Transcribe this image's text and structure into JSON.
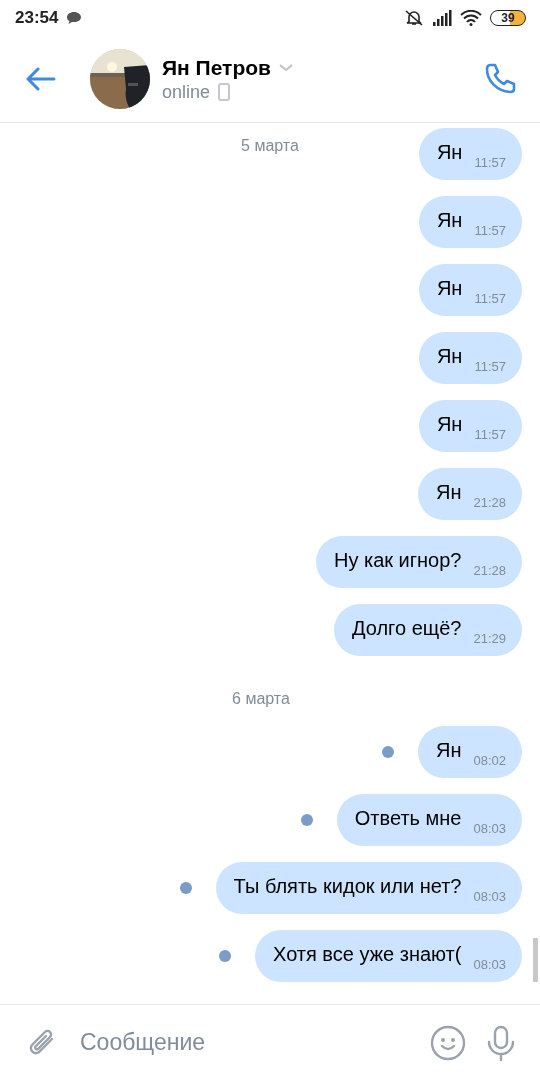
{
  "status_bar": {
    "time": "23:54",
    "battery": "39"
  },
  "header": {
    "name": "Ян Петров",
    "status": "online"
  },
  "sticky_date": "5 марта",
  "messages": [
    {
      "kind": "message",
      "text": "Ян",
      "time": "11:57",
      "unread": false
    },
    {
      "kind": "message",
      "text": "Ян",
      "time": "11:57",
      "unread": false
    },
    {
      "kind": "message",
      "text": "Ян",
      "time": "11:57",
      "unread": false
    },
    {
      "kind": "message",
      "text": "Ян",
      "time": "11:57",
      "unread": false
    },
    {
      "kind": "message",
      "text": "Ян",
      "time": "11:57",
      "unread": false
    },
    {
      "kind": "message",
      "text": "Ян",
      "time": "21:28",
      "unread": false
    },
    {
      "kind": "message",
      "text": "Ну как игнор?",
      "time": "21:28",
      "unread": false
    },
    {
      "kind": "message",
      "text": "Долго ещё?",
      "time": "21:29",
      "unread": false
    },
    {
      "kind": "date",
      "text": "6 марта"
    },
    {
      "kind": "message",
      "text": "Ян",
      "time": "08:02",
      "unread": true
    },
    {
      "kind": "message",
      "text": "Ответь мне",
      "time": "08:03",
      "unread": true
    },
    {
      "kind": "message",
      "text": "Ты блять кидок или нет?",
      "time": "08:03",
      "unread": true
    },
    {
      "kind": "message",
      "text": "Хотя все уже знают(",
      "time": "08:03",
      "unread": true
    }
  ],
  "composer": {
    "placeholder": "Сообщение"
  }
}
